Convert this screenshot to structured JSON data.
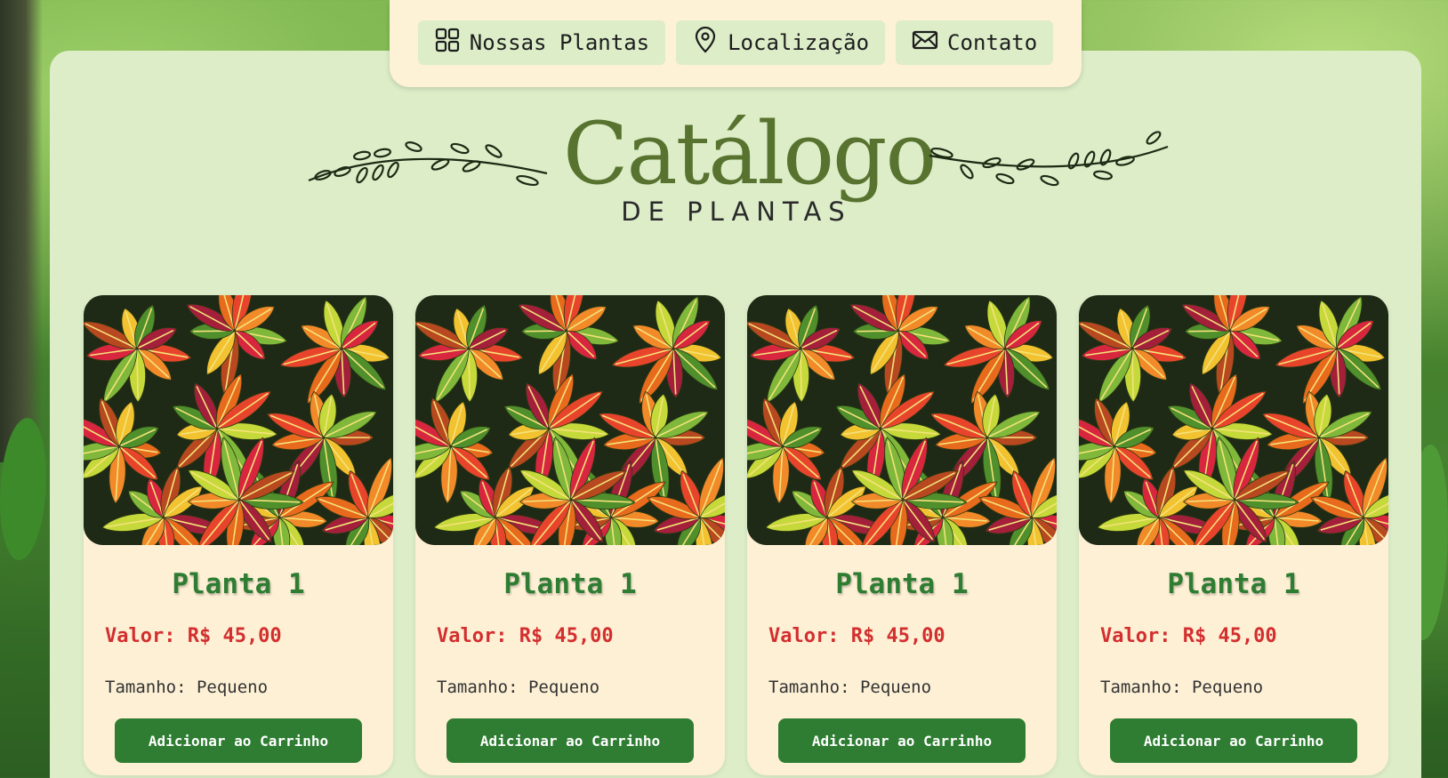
{
  "nav": {
    "items": [
      {
        "label": "Nossas Plantas",
        "icon": "grid-icon"
      },
      {
        "label": "Localização",
        "icon": "location-pin-icon"
      },
      {
        "label": "Contato",
        "icon": "mail-icon"
      }
    ]
  },
  "logo": {
    "title": "Catálogo",
    "subtitle": "DE PLANTAS"
  },
  "products": [
    {
      "name": "Planta 1",
      "price": "Valor: R$ 45,00",
      "size": "Tamanho: Pequeno",
      "button": "Adicionar ao Carrinho"
    },
    {
      "name": "Planta 1",
      "price": "Valor: R$ 45,00",
      "size": "Tamanho: Pequeno",
      "button": "Adicionar ao Carrinho"
    },
    {
      "name": "Planta 1",
      "price": "Valor: R$ 45,00",
      "size": "Tamanho: Pequeno",
      "button": "Adicionar ao Carrinho"
    },
    {
      "name": "Planta 1",
      "price": "Valor: R$ 45,00",
      "size": "Tamanho: Pequeno",
      "button": "Adicionar ao Carrinho"
    }
  ],
  "colors": {
    "panel": "#dcedc8",
    "card": "#fdf0d5",
    "accent_green": "#2e7d32",
    "price_red": "#d32f2f",
    "logo_green": "#58732f"
  }
}
